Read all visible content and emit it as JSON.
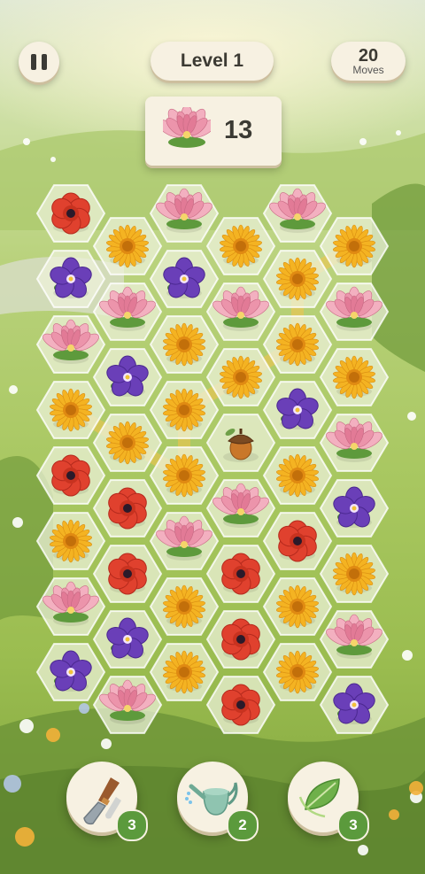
{
  "hud": {
    "level_label": "Level 1",
    "moves_value": "20",
    "moves_label": "Moves"
  },
  "goal": {
    "flower": "lotus",
    "count": "13"
  },
  "colors": {
    "poppy": "#e0412e",
    "daisy": "#f4b322",
    "violet": "#6a3fb8",
    "lotus": "#e98aa2",
    "hex_fill": "#eef3dc",
    "panel": "#f7f1e2",
    "badge": "#5b9a3c"
  },
  "board": {
    "columns": [
      [
        "poppy",
        "violet",
        "lotus",
        "daisy",
        "poppy",
        "daisy",
        "lotus",
        "violet"
      ],
      [
        "daisy",
        "lotus",
        "violet",
        "daisy",
        "poppy",
        "poppy",
        "violet",
        "lotus"
      ],
      [
        "lotus",
        "violet",
        "daisy",
        "daisy",
        "daisy",
        "lotus",
        "daisy",
        "daisy"
      ],
      [
        "daisy",
        "lotus",
        "daisy",
        "acorn",
        "lotus",
        "poppy",
        "poppy",
        "poppy"
      ],
      [
        "lotus",
        "daisy",
        "daisy",
        "violet",
        "daisy",
        "poppy",
        "daisy",
        "daisy"
      ],
      [
        "daisy",
        "lotus",
        "daisy",
        "lotus",
        "violet",
        "daisy",
        "lotus",
        "violet"
      ]
    ],
    "highlight_path": [
      "0,3",
      "1,3",
      "2,4",
      "2,3",
      "3,2",
      "4,2",
      "4,1",
      "5,0"
    ]
  },
  "tools": [
    {
      "name": "trowel",
      "count": "3"
    },
    {
      "name": "watering-can",
      "count": "2"
    },
    {
      "name": "leaf",
      "count": "3"
    }
  ]
}
